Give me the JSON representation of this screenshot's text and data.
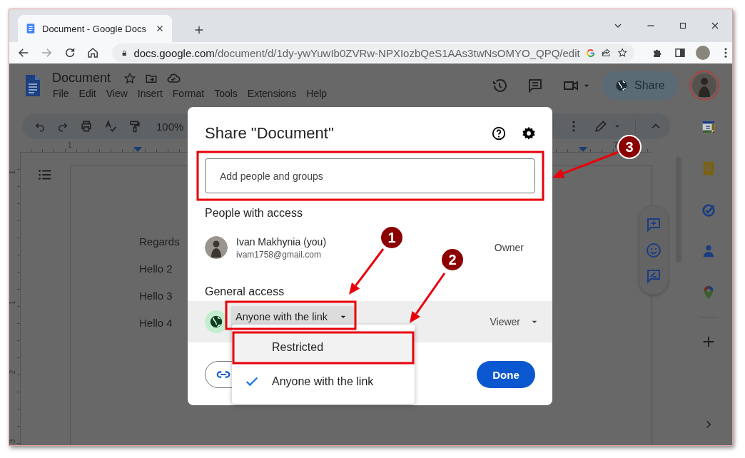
{
  "browser": {
    "tab": {
      "title": "Document - Google Docs"
    },
    "url": {
      "host": "docs.google.com",
      "path": "/document/d/1dy-ywYuwIb0ZVRw-NPXIozbQeS1AAs3twNsOMYO_QPQ/edit"
    },
    "forward_disabled": true
  },
  "docs": {
    "title": "Document",
    "menu": [
      "File",
      "Edit",
      "View",
      "Insert",
      "Format",
      "Tools",
      "Extensions",
      "Help"
    ],
    "share_button": "Share",
    "zoom": "100%",
    "ruler_labels": [
      "1",
      "7"
    ],
    "vertical_ruler_labels": [
      "1",
      "1",
      "2",
      "3"
    ],
    "lines": [
      "Regards",
      "Hello 2",
      "Hello 3",
      "Hello 4"
    ]
  },
  "dialog": {
    "title": "Share \"Document\"",
    "input": {
      "placeholder": "Add people and groups"
    },
    "people_heading": "People with access",
    "people": [
      {
        "name": "Ivan Makhynia (you)",
        "email": "ivam1758@gmail.com",
        "role": "Owner"
      }
    ],
    "general_heading": "General access",
    "access": "Anyone with the link",
    "access_role": "Viewer",
    "done_button": "Done"
  },
  "access_menu": [
    {
      "label": "Restricted",
      "selected": false,
      "hovered": true
    },
    {
      "label": "Anyone with the link",
      "selected": true,
      "hovered": false
    }
  ],
  "annotations": [
    {
      "number": "1"
    },
    {
      "number": "2"
    },
    {
      "number": "3"
    }
  ]
}
